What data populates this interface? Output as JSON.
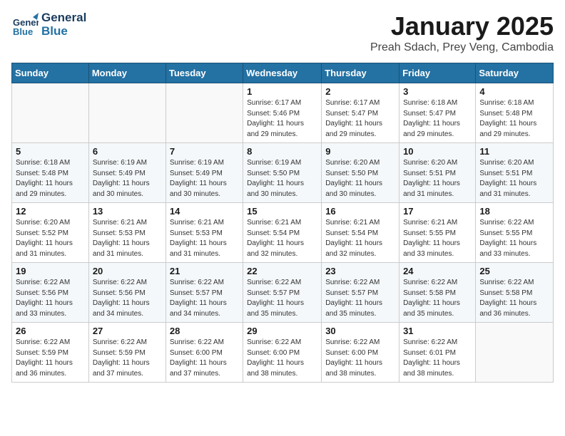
{
  "header": {
    "logo_general": "General",
    "logo_blue": "Blue",
    "title": "January 2025",
    "subtitle": "Preah Sdach, Prey Veng, Cambodia"
  },
  "days_of_week": [
    "Sunday",
    "Monday",
    "Tuesday",
    "Wednesday",
    "Thursday",
    "Friday",
    "Saturday"
  ],
  "weeks": [
    {
      "days": [
        {
          "number": "",
          "info": ""
        },
        {
          "number": "",
          "info": ""
        },
        {
          "number": "",
          "info": ""
        },
        {
          "number": "1",
          "info": "Sunrise: 6:17 AM\nSunset: 5:46 PM\nDaylight: 11 hours and 29 minutes."
        },
        {
          "number": "2",
          "info": "Sunrise: 6:17 AM\nSunset: 5:47 PM\nDaylight: 11 hours and 29 minutes."
        },
        {
          "number": "3",
          "info": "Sunrise: 6:18 AM\nSunset: 5:47 PM\nDaylight: 11 hours and 29 minutes."
        },
        {
          "number": "4",
          "info": "Sunrise: 6:18 AM\nSunset: 5:48 PM\nDaylight: 11 hours and 29 minutes."
        }
      ]
    },
    {
      "days": [
        {
          "number": "5",
          "info": "Sunrise: 6:18 AM\nSunset: 5:48 PM\nDaylight: 11 hours and 29 minutes."
        },
        {
          "number": "6",
          "info": "Sunrise: 6:19 AM\nSunset: 5:49 PM\nDaylight: 11 hours and 30 minutes."
        },
        {
          "number": "7",
          "info": "Sunrise: 6:19 AM\nSunset: 5:49 PM\nDaylight: 11 hours and 30 minutes."
        },
        {
          "number": "8",
          "info": "Sunrise: 6:19 AM\nSunset: 5:50 PM\nDaylight: 11 hours and 30 minutes."
        },
        {
          "number": "9",
          "info": "Sunrise: 6:20 AM\nSunset: 5:50 PM\nDaylight: 11 hours and 30 minutes."
        },
        {
          "number": "10",
          "info": "Sunrise: 6:20 AM\nSunset: 5:51 PM\nDaylight: 11 hours and 31 minutes."
        },
        {
          "number": "11",
          "info": "Sunrise: 6:20 AM\nSunset: 5:51 PM\nDaylight: 11 hours and 31 minutes."
        }
      ]
    },
    {
      "days": [
        {
          "number": "12",
          "info": "Sunrise: 6:20 AM\nSunset: 5:52 PM\nDaylight: 11 hours and 31 minutes."
        },
        {
          "number": "13",
          "info": "Sunrise: 6:21 AM\nSunset: 5:53 PM\nDaylight: 11 hours and 31 minutes."
        },
        {
          "number": "14",
          "info": "Sunrise: 6:21 AM\nSunset: 5:53 PM\nDaylight: 11 hours and 31 minutes."
        },
        {
          "number": "15",
          "info": "Sunrise: 6:21 AM\nSunset: 5:54 PM\nDaylight: 11 hours and 32 minutes."
        },
        {
          "number": "16",
          "info": "Sunrise: 6:21 AM\nSunset: 5:54 PM\nDaylight: 11 hours and 32 minutes."
        },
        {
          "number": "17",
          "info": "Sunrise: 6:21 AM\nSunset: 5:55 PM\nDaylight: 11 hours and 33 minutes."
        },
        {
          "number": "18",
          "info": "Sunrise: 6:22 AM\nSunset: 5:55 PM\nDaylight: 11 hours and 33 minutes."
        }
      ]
    },
    {
      "days": [
        {
          "number": "19",
          "info": "Sunrise: 6:22 AM\nSunset: 5:56 PM\nDaylight: 11 hours and 33 minutes."
        },
        {
          "number": "20",
          "info": "Sunrise: 6:22 AM\nSunset: 5:56 PM\nDaylight: 11 hours and 34 minutes."
        },
        {
          "number": "21",
          "info": "Sunrise: 6:22 AM\nSunset: 5:57 PM\nDaylight: 11 hours and 34 minutes."
        },
        {
          "number": "22",
          "info": "Sunrise: 6:22 AM\nSunset: 5:57 PM\nDaylight: 11 hours and 35 minutes."
        },
        {
          "number": "23",
          "info": "Sunrise: 6:22 AM\nSunset: 5:57 PM\nDaylight: 11 hours and 35 minutes."
        },
        {
          "number": "24",
          "info": "Sunrise: 6:22 AM\nSunset: 5:58 PM\nDaylight: 11 hours and 35 minutes."
        },
        {
          "number": "25",
          "info": "Sunrise: 6:22 AM\nSunset: 5:58 PM\nDaylight: 11 hours and 36 minutes."
        }
      ]
    },
    {
      "days": [
        {
          "number": "26",
          "info": "Sunrise: 6:22 AM\nSunset: 5:59 PM\nDaylight: 11 hours and 36 minutes."
        },
        {
          "number": "27",
          "info": "Sunrise: 6:22 AM\nSunset: 5:59 PM\nDaylight: 11 hours and 37 minutes."
        },
        {
          "number": "28",
          "info": "Sunrise: 6:22 AM\nSunset: 6:00 PM\nDaylight: 11 hours and 37 minutes."
        },
        {
          "number": "29",
          "info": "Sunrise: 6:22 AM\nSunset: 6:00 PM\nDaylight: 11 hours and 38 minutes."
        },
        {
          "number": "30",
          "info": "Sunrise: 6:22 AM\nSunset: 6:00 PM\nDaylight: 11 hours and 38 minutes."
        },
        {
          "number": "31",
          "info": "Sunrise: 6:22 AM\nSunset: 6:01 PM\nDaylight: 11 hours and 38 minutes."
        },
        {
          "number": "",
          "info": ""
        }
      ]
    }
  ]
}
